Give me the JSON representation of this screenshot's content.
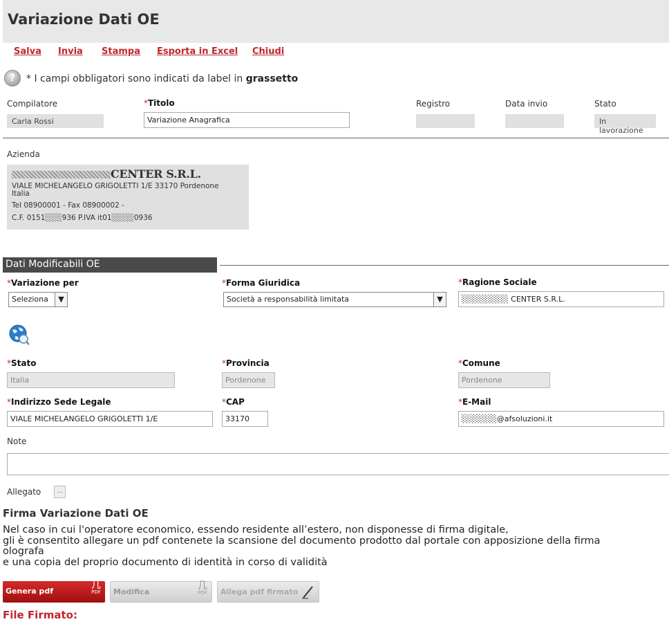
{
  "page": {
    "title": "Variazione Dati OE"
  },
  "toolbar": {
    "salva": "Salva",
    "invia": "Invia",
    "stampa": "Stampa",
    "esporta": "Esporta in Excel",
    "chiudi": "Chiudi"
  },
  "help": {
    "icon": "help-icon",
    "text": "* I campi obbligatori sono indicati da label in ",
    "bold": "grassetto"
  },
  "header_fields": {
    "compilatore_label": "Compilatore",
    "compilatore_value": "Carla Rossi",
    "titolo_label": "Titolo",
    "titolo_value": "Variazione Anagrafica",
    "registro_label": "Registro",
    "registro_value": "",
    "data_invio_label": "Data invio",
    "data_invio_value": "",
    "stato_label": "Stato",
    "stato_value": "In lavorazione"
  },
  "azienda": {
    "label": "Azienda",
    "name": "CENTER S.R.L.",
    "address": "VIALE MICHELANGELO GRIGOLETTI 1/E 33170 Pordenone",
    "country": "Italia",
    "phone": "Tel 08900001 - Fax 08900002 -",
    "fiscal": "C.F. 0151░░░936 P.IVA it01░░░░0936"
  },
  "section": {
    "title": "Dati Modificabili OE"
  },
  "form": {
    "variazione_label": "Variazione per",
    "variazione_value": "Seleziona",
    "forma_label": "Forma Giuridica",
    "forma_value": "Società a responsabilità limitata",
    "ragione_label": "Ragione Sociale",
    "ragione_value": "░░░░░░░░ CENTER S.R.L.",
    "stato_label": "Stato",
    "stato_value": "Italia",
    "provincia_label": "Provincia",
    "provincia_value": "Pordenone",
    "comune_label": "Comune",
    "comune_value": "Pordenone",
    "indirizzo_label": "Indirizzo Sede Legale",
    "indirizzo_value": "VIALE MICHELANGELO GRIGOLETTI 1/E",
    "cap_label": "CAP",
    "cap_value": "33170",
    "email_label": "E-Mail",
    "email_value": "░░░░░░@afsoluzioni.it",
    "note_label": "Note",
    "note_value": "",
    "allegato_label": "Allegato",
    "allegato_button": "..."
  },
  "firma": {
    "title": "Firma Variazione Dati OE",
    "line1": "Nel caso in cui l'operatore economico, essendo residente all’estero, non disponesse di firma digitale,",
    "line2": "gli è consentito allegare un pdf contenete la scansione del documento prodotto dal portale con apposizione della firma",
    "line3": "olografa",
    "line4": "e una copia del proprio documento di identità in corso di validità"
  },
  "buttons": {
    "genera": "Genera pdf",
    "modifica": "Modifica",
    "allega": "Allega pdf firmato",
    "pdf_tag": "PDF"
  },
  "file_firmato": "File Firmato:",
  "colors": {
    "accent": "#c0262c",
    "section_bg": "#4a4a4a",
    "header_bg": "#e8e8e8"
  }
}
